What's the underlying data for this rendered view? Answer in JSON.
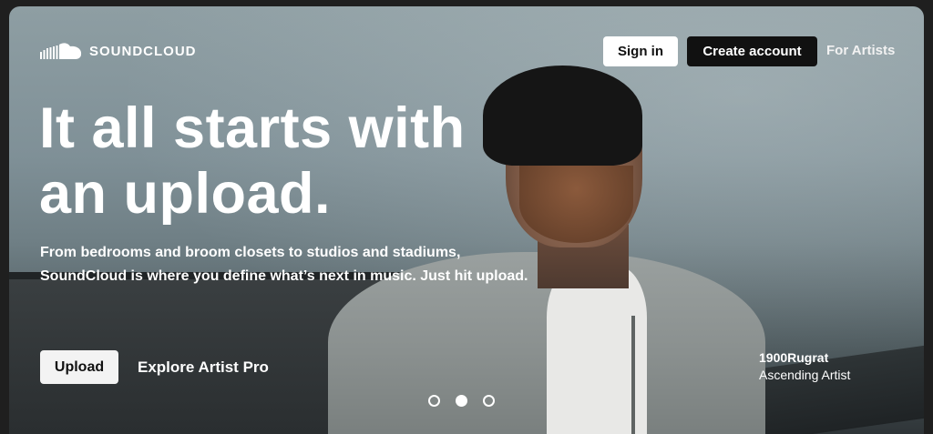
{
  "brand": {
    "name": "SOUNDCLOUD",
    "icon": "soundcloud-cloud-icon"
  },
  "nav": {
    "signin_label": "Sign in",
    "create_account_label": "Create account",
    "for_artists_label": "For Artists"
  },
  "hero": {
    "headline": "It all starts with an upload.",
    "subtext": "From bedrooms and broom closets to studios and stadiums, SoundCloud is where you define what’s next in music. Just hit upload.",
    "upload_label": "Upload",
    "explore_label": "Explore Artist Pro",
    "artist_name": "1900Rugrat",
    "artist_title": "Ascending Artist"
  },
  "carousel": {
    "total": 3,
    "active_index": 1
  },
  "colors": {
    "accent_dark": "#111111",
    "text_light": "#ffffff"
  }
}
